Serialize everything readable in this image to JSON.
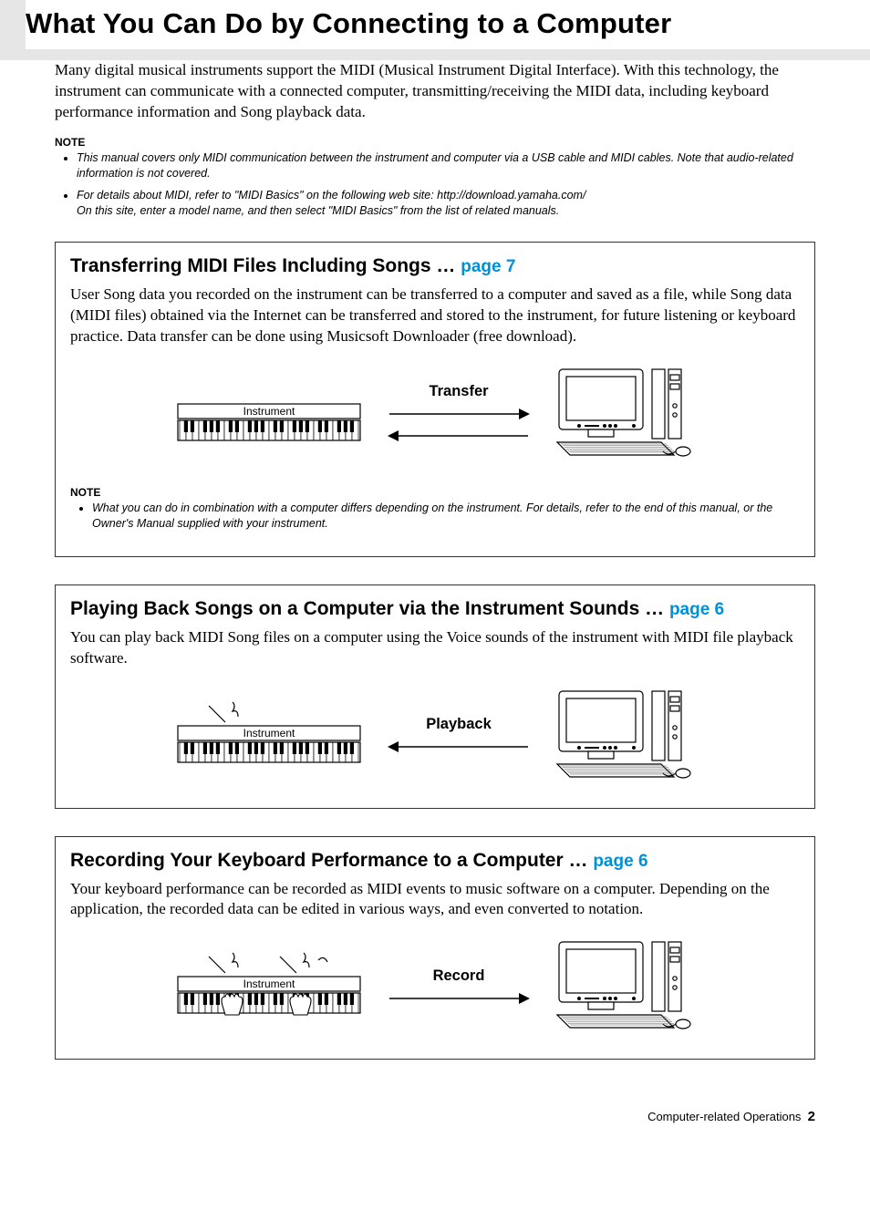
{
  "title": "What You Can Do by Connecting to a Computer",
  "intro": "Many digital musical instruments support the MIDI (Musical Instrument Digital Interface). With this technology, the instrument can communicate with a connected computer, transmitting/receiving the MIDI data, including keyboard performance information and Song playback data.",
  "notes_top": {
    "heading": "NOTE",
    "items": [
      {
        "text": "This manual covers only MIDI communication between the instrument and computer via a USB cable and MIDI cables. Note that audio-related information is not covered."
      },
      {
        "text": "For details about MIDI, refer to \"MIDI Basics\" on the following web site: http://download.yamaha.com/",
        "sub": "On this site, enter a model name, and then select \"MIDI Basics\" from the list of related manuals."
      }
    ]
  },
  "sections": [
    {
      "title": "Transferring MIDI Files Including Songs … ",
      "page_ref": "page 7",
      "body": "User Song data you recorded on the instrument can be transferred to a computer and saved as a file, while Song data (MIDI files) obtained via the Internet can be transferred and stored to the instrument, for future listening or keyboard practice. Data transfer can be done using Musicsoft Downloader (free download).",
      "diagram": {
        "instrument_label": "Instrument",
        "arrow_label": "Transfer",
        "arrows": "both",
        "music_notes": false,
        "playing_hands": false
      },
      "note": {
        "heading": "NOTE",
        "items": [
          {
            "text": "What you can do in combination with a computer differs depending on the instrument. For details, refer to the end of this manual, or the Owner's Manual supplied with your instrument."
          }
        ]
      }
    },
    {
      "title": "Playing Back Songs on a Computer via the Instrument Sounds … ",
      "page_ref": "page 6",
      "body": "You can play back MIDI Song files on a computer using the Voice sounds of the instrument with MIDI file playback software.",
      "diagram": {
        "instrument_label": "Instrument",
        "arrow_label": "Playback",
        "arrows": "left",
        "music_notes": true,
        "playing_hands": false
      }
    },
    {
      "title": "Recording Your Keyboard Performance to a Computer … ",
      "page_ref": "page 6",
      "body": "Your keyboard performance can be recorded as MIDI events to music software on a computer. Depending on the application, the recorded data can be edited in various ways, and even converted to notation.",
      "diagram": {
        "instrument_label": "Instrument",
        "arrow_label": "Record",
        "arrows": "right",
        "music_notes": true,
        "playing_hands": true
      }
    }
  ],
  "footer": {
    "label": "Computer-related Operations",
    "page": "2"
  }
}
